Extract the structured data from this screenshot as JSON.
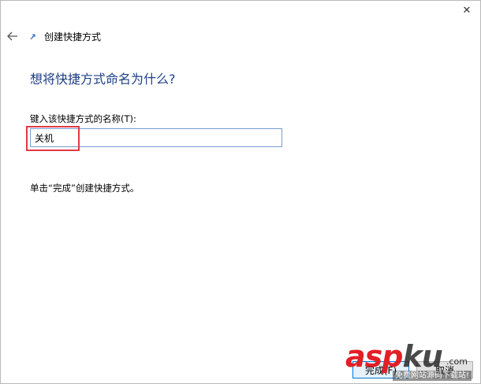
{
  "window": {
    "close_symbol": "✕"
  },
  "header": {
    "back_icon": "back-arrow-icon",
    "wizard_icon": "shortcut-wizard-icon",
    "title": "创建快捷方式"
  },
  "main": {
    "heading": "想将快捷方式命名为什么?",
    "field_label": "键入该快捷方式的名称(T):",
    "name_value": "关机",
    "instruction": "单击“完成”创建快捷方式。"
  },
  "footer": {
    "finish_label": "完成(F)",
    "cancel_label": "取消"
  },
  "watermark": {
    "asp": "asp",
    "ku": "ku",
    "com": ".com",
    "sub": "免费网站源码下载站!"
  },
  "colors": {
    "heading": "#1e3f86",
    "input_border": "#7a9cd3",
    "highlight": "#e03a47",
    "watermark_red": "#e21f26"
  }
}
